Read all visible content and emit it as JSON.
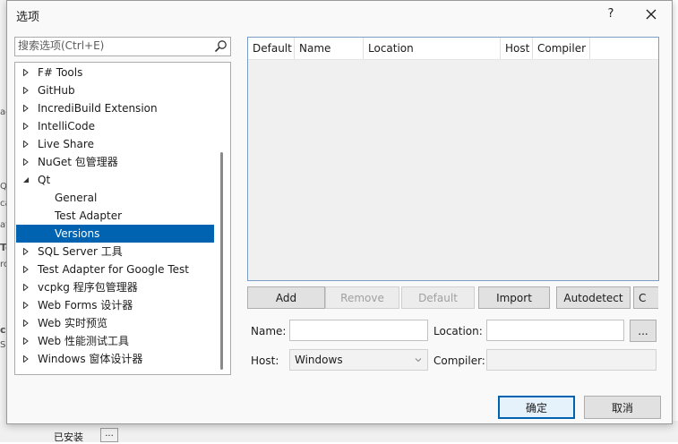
{
  "background": {
    "left_fragments": [
      "Te",
      "ac",
      "Qt",
      "ca",
      "at",
      "To",
      "ro",
      "co",
      "S"
    ],
    "bottom_texts": [
      "已安装",
      "..."
    ]
  },
  "dialog": {
    "title": "选项",
    "help_label": "?",
    "close_icon": "close-icon"
  },
  "search": {
    "placeholder": "搜索选项(Ctrl+E)",
    "icon": "search-icon"
  },
  "tree": {
    "items": [
      {
        "label": "F# Tools",
        "expanded": false,
        "level": 0
      },
      {
        "label": "GitHub",
        "expanded": false,
        "level": 0
      },
      {
        "label": "IncrediBuild Extension",
        "expanded": false,
        "level": 0
      },
      {
        "label": "IntelliCode",
        "expanded": false,
        "level": 0
      },
      {
        "label": "Live Share",
        "expanded": false,
        "level": 0
      },
      {
        "label": "NuGet 包管理器",
        "expanded": false,
        "level": 0
      },
      {
        "label": "Qt",
        "expanded": true,
        "level": 0
      },
      {
        "label": "General",
        "level": 1
      },
      {
        "label": "Test Adapter",
        "level": 1
      },
      {
        "label": "Versions",
        "level": 1,
        "selected": true
      },
      {
        "label": "SQL Server 工具",
        "expanded": false,
        "level": 0
      },
      {
        "label": "Test Adapter for Google Test",
        "expanded": false,
        "level": 0
      },
      {
        "label": "vcpkg 程序包管理器",
        "expanded": false,
        "level": 0
      },
      {
        "label": "Web Forms 设计器",
        "expanded": false,
        "level": 0
      },
      {
        "label": "Web 实时预览",
        "expanded": false,
        "level": 0
      },
      {
        "label": "Web 性能测试工具",
        "expanded": false,
        "level": 0
      },
      {
        "label": "Windows 窗体设计器",
        "expanded": false,
        "level": 0
      }
    ]
  },
  "versions_table": {
    "columns": [
      "Default",
      "Name",
      "Location",
      "Host",
      "Compiler"
    ]
  },
  "buttons": {
    "add": "Add",
    "remove": "Remove",
    "default": "Default",
    "import": "Import",
    "autodetect": "Autodetect",
    "clipped": "C"
  },
  "form": {
    "name_label": "Name:",
    "name_value": "",
    "location_label": "Location:",
    "location_value": "",
    "browse_label": "...",
    "host_label": "Host:",
    "host_value": "Windows",
    "compiler_label": "Compiler:",
    "compiler_value": ""
  },
  "footer": {
    "ok": "确定",
    "cancel": "取消"
  },
  "colors": {
    "selection": "#0063b1",
    "default_button_border": "#0063b1"
  }
}
